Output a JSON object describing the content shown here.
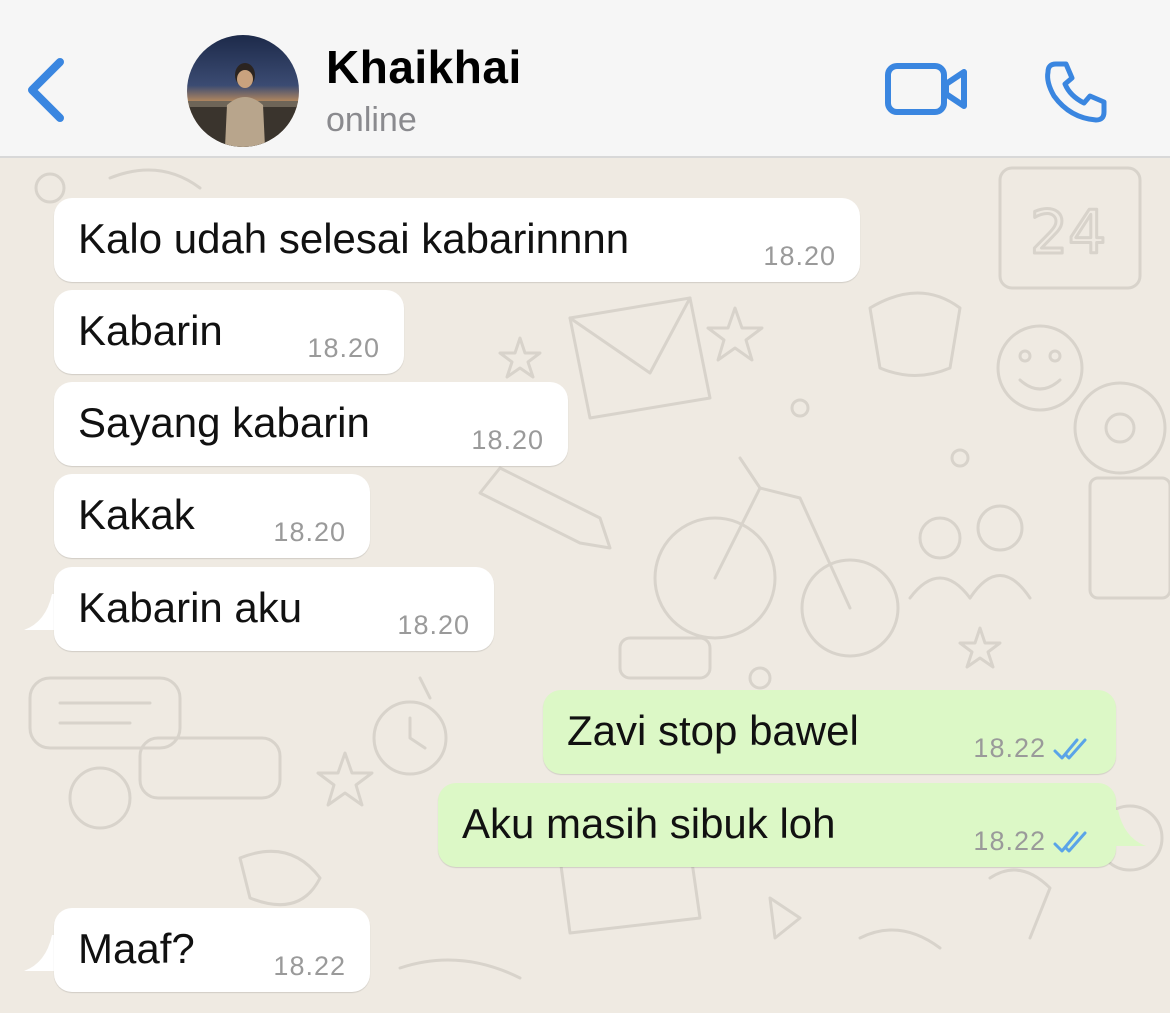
{
  "header": {
    "contact_name": "Khaikhai",
    "status": "online",
    "icons": {
      "back": "chevron-left-icon",
      "video": "video-camera-icon",
      "call": "phone-icon"
    },
    "accent_color": "#3a86e0"
  },
  "messages": [
    {
      "direction": "incoming",
      "text": "Kalo udah selesai kabarinnnn",
      "time": "18.20"
    },
    {
      "direction": "incoming",
      "text": "Kabarin",
      "time": "18.20"
    },
    {
      "direction": "incoming",
      "text": "Sayang kabarin",
      "time": "18.20"
    },
    {
      "direction": "incoming",
      "text": "Kakak",
      "time": "18.20"
    },
    {
      "direction": "incoming",
      "text": "Kabarin aku",
      "time": "18.20"
    },
    {
      "direction": "outgoing",
      "text": "Zavi stop bawel",
      "time": "18.22",
      "status": "read"
    },
    {
      "direction": "outgoing",
      "text": "Aku masih sibuk loh",
      "time": "18.22",
      "status": "read"
    },
    {
      "direction": "incoming",
      "text": "Maaf?",
      "time": "18.22"
    }
  ],
  "colors": {
    "incoming_bubble": "#ffffff",
    "outgoing_bubble": "#dcf8c6",
    "read_ticks": "#5aa4e8",
    "wallpaper": "#efeae2"
  }
}
